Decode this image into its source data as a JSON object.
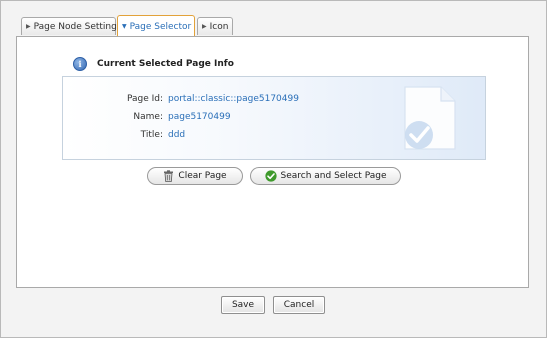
{
  "tabs": [
    {
      "label": "Page Node Setting",
      "active": false
    },
    {
      "label": "Page Selector",
      "active": true
    },
    {
      "label": "Icon",
      "active": false
    }
  ],
  "info": {
    "title": "Current Selected Page Info",
    "icon": "info-icon",
    "fields": [
      {
        "label": "Page Id:",
        "value": "portal::classic::page5170499"
      },
      {
        "label": "Name:",
        "value": "page5170499"
      },
      {
        "label": "Title:",
        "value": "ddd"
      }
    ]
  },
  "actions": {
    "clear_label": "Clear Page",
    "clear_icon": "trash-icon",
    "search_label": "Search and Select Page",
    "search_icon": "check-circle-icon"
  },
  "footer": {
    "save_label": "Save",
    "cancel_label": "Cancel"
  },
  "colors": {
    "accent": "#2a6fb8",
    "active_tab_border": "#e2a23a",
    "check_green": "#3f9a2c"
  }
}
